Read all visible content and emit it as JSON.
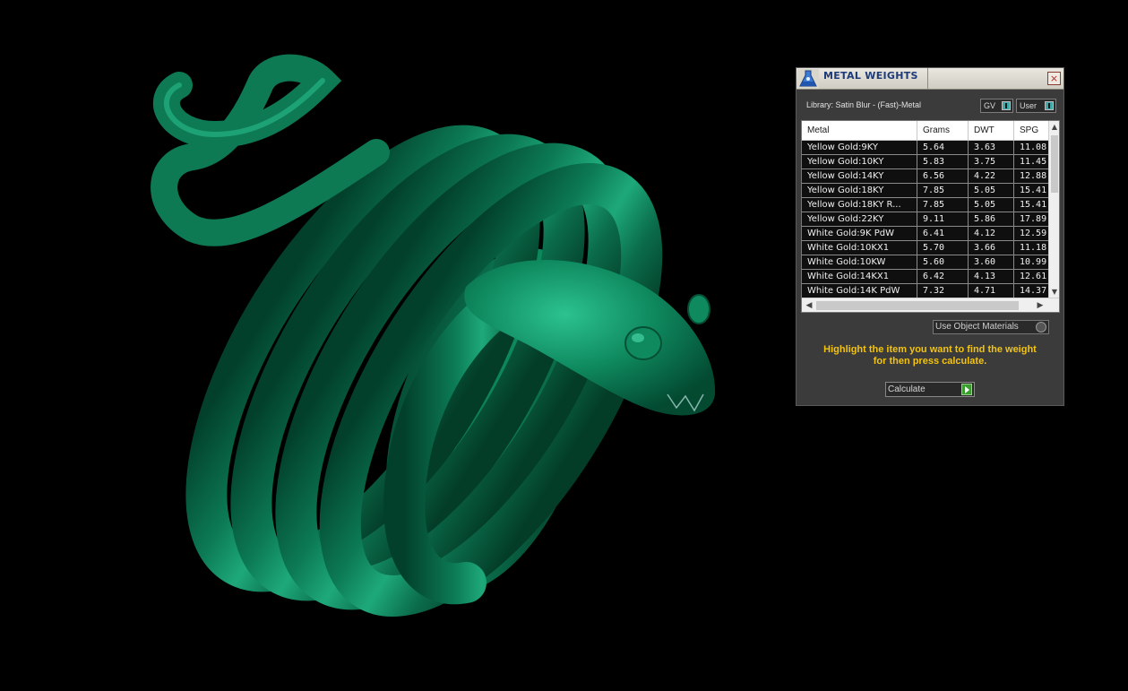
{
  "viewport": {
    "object": "snake ring",
    "background_color": "#000000",
    "material_color": "#0a7a55"
  },
  "panel": {
    "title": "METAL WEIGHTS",
    "close_label": "×",
    "title_icon": "flask-icon",
    "library_label": "Library: Satin Blur - (Fast)-Metal",
    "gv_toggle_label": "GV",
    "user_toggle_label": "User",
    "table": {
      "columns": [
        "Metal",
        "Grams",
        "DWT",
        "SPG"
      ],
      "rows": [
        [
          "Yellow Gold:9KY",
          "5.64",
          "3.63",
          "11.08"
        ],
        [
          "Yellow Gold:10KY",
          "5.83",
          "3.75",
          "11.45"
        ],
        [
          "Yellow Gold:14KY",
          "6.56",
          "4.22",
          "12.88"
        ],
        [
          "Yellow Gold:18KY",
          "7.85",
          "5.05",
          "15.41"
        ],
        [
          "Yellow Gold:18KY R...",
          "7.85",
          "5.05",
          "15.41"
        ],
        [
          "Yellow Gold:22KY",
          "9.11",
          "5.86",
          "17.89"
        ],
        [
          "White Gold:9K PdW",
          "6.41",
          "4.12",
          "12.59"
        ],
        [
          "White Gold:10KX1",
          "5.70",
          "3.66",
          "11.18"
        ],
        [
          "White Gold:10KW",
          "5.60",
          "3.60",
          "10.99"
        ],
        [
          "White Gold:14KX1",
          "6.42",
          "4.13",
          "12.61"
        ],
        [
          "White Gold:14K PdW",
          "7.32",
          "4.71",
          "14.37"
        ]
      ]
    },
    "use_object_label": "Use Object Materials",
    "hint_line1": "Highlight the item you want to find the weight",
    "hint_line2": "for then press calculate.",
    "calculate_label": "Calculate",
    "colors": {
      "hint": "#f3c30f",
      "panel_bg": "#3b3b3b",
      "title_text": "#1e3a78",
      "toggle_accent": "#3fa7a8",
      "go_button": "#3a9e2f"
    }
  }
}
